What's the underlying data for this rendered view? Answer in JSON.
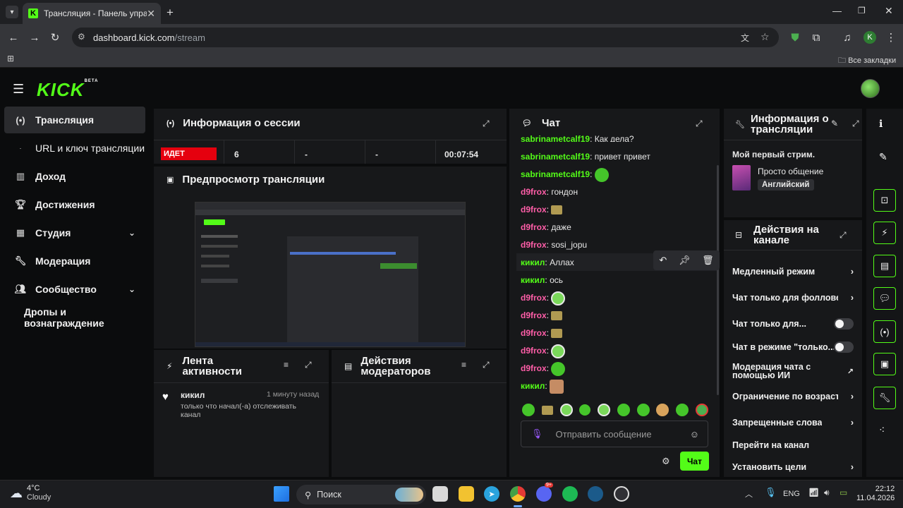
{
  "browser": {
    "tab_title": "Трансляция - Панель управле",
    "tab_favicon": "K",
    "url_host": "dashboard.kick.com",
    "url_path": "/stream",
    "bookmarks_all": "Все закладки",
    "profile_initial": "K"
  },
  "app": {
    "logo": "KICK",
    "logo_badge": "BETA"
  },
  "sidebar": {
    "items": [
      {
        "label": "Трансляция",
        "icon": "broadcast-icon"
      },
      {
        "label": "URL и ключ трансляции",
        "icon": ""
      },
      {
        "label": "Доход",
        "icon": "chart-icon"
      },
      {
        "label": "Достижения",
        "icon": "trophy-icon"
      },
      {
        "label": "Студия",
        "icon": "grid-icon"
      },
      {
        "label": "Модерация",
        "icon": "wrench-icon"
      },
      {
        "label": "Сообщество",
        "icon": "people-icon"
      },
      {
        "label": "Дропы и вознаграждение",
        "icon": ""
      }
    ]
  },
  "session": {
    "title": "Информация о сессии",
    "status": "ИДЕТ",
    "viewers": "6",
    "stat2": "-",
    "stat3": "-",
    "duration": "00:07:54"
  },
  "preview": {
    "title": "Предпросмотр трансляции"
  },
  "activity": {
    "title": "Лента активности",
    "user": "кикил",
    "time": "1 минуту назад",
    "text": "только что начал(-а) отслеживать канал"
  },
  "modactions": {
    "title": "Действия модераторов"
  },
  "chat": {
    "title": "Чат",
    "messages": [
      {
        "user": "sabrinametcalf19",
        "text": "Как дела?",
        "color": "green"
      },
      {
        "user": "sabrinametcalf19",
        "text": "привет привет",
        "color": "green"
      },
      {
        "user": "sabrinametcalf19",
        "text": "",
        "color": "green"
      },
      {
        "user": "d9frox",
        "text": "гондон",
        "color": "pink"
      },
      {
        "user": "d9frox",
        "text": "",
        "color": "pink"
      },
      {
        "user": "d9frox",
        "text": "даже",
        "color": "pink"
      },
      {
        "user": "d9frox",
        "text": "sosi_jopu",
        "color": "pink"
      },
      {
        "user": "кикил",
        "text": "Аллах",
        "color": "green"
      },
      {
        "user": "кикил",
        "text": "ось",
        "color": "green"
      },
      {
        "user": "d9frox",
        "text": "",
        "color": "pink"
      },
      {
        "user": "d9frox",
        "text": "",
        "color": "pink"
      },
      {
        "user": "d9frox",
        "text": "",
        "color": "pink"
      },
      {
        "user": "d9frox",
        "text": "",
        "color": "pink"
      },
      {
        "user": "d9frox",
        "text": "",
        "color": "pink"
      },
      {
        "user": "кикил",
        "text": "",
        "color": "green"
      }
    ],
    "input_placeholder": "Отправить сообщение",
    "send_label": "Чат"
  },
  "stream_info": {
    "title": "Информация о трансляции",
    "stream_title": "Мой первый стрим.",
    "category": "Просто общение",
    "language": "Английский"
  },
  "channel_actions": {
    "title": "Действия на канале",
    "items": [
      {
        "label": "Медленный режим",
        "control": "chevron"
      },
      {
        "label": "Чат только для фолловерс",
        "control": "chevron"
      },
      {
        "label": "Чат только для...",
        "control": "toggle"
      },
      {
        "label": "Чат в режиме \"только...",
        "control": "toggle"
      },
      {
        "label": "Модерация чата с помощью ИИ",
        "control": "external"
      },
      {
        "label": "Ограничение по возрасту",
        "control": "chevron"
      },
      {
        "label": "Запрещенные слова",
        "control": "chevron"
      },
      {
        "label": "Перейти на канал",
        "control": "none"
      },
      {
        "label": "Установить цели",
        "control": "chevron"
      }
    ]
  },
  "taskbar": {
    "weather_temp": "4°C",
    "weather_text": "Cloudy",
    "search": "Поиск",
    "lang": "ENG",
    "time": "22:12",
    "date": "11.04.2026",
    "discord_badge": "9+"
  },
  "colors": {
    "accent": "#53fc18",
    "live": "#e5000e",
    "pink": "#ff5ea8"
  }
}
